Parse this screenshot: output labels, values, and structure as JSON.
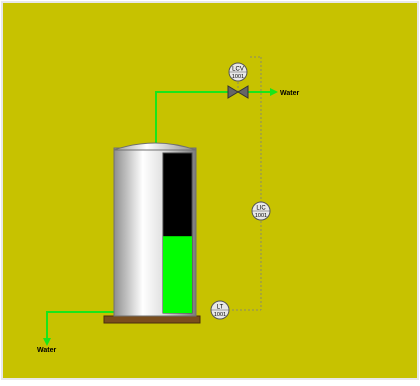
{
  "colors": {
    "background": "#c7c200",
    "pipe": "#19e619",
    "level_fill": "#00ff00",
    "vessel_empty": "#000000",
    "base": "#7a4e1d",
    "signal_line": "#8a8a6a"
  },
  "streams": {
    "outlet_label": "Water",
    "inlet_label": "Water"
  },
  "instruments": {
    "lcv": {
      "tag": "LCV",
      "number": "1001"
    },
    "lic": {
      "tag": "LIC",
      "number": "1001"
    },
    "lt": {
      "tag": "LT",
      "number": "1001"
    }
  },
  "tank": {
    "level_fraction": 0.48
  },
  "icons": [
    "valve-icon",
    "arrow-right-icon",
    "arrow-down-icon"
  ]
}
